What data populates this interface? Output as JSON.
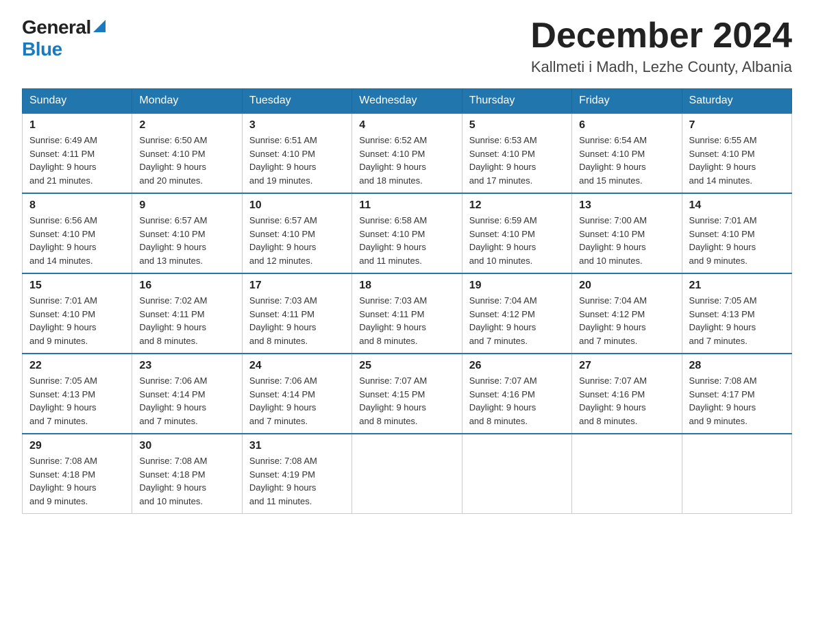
{
  "header": {
    "logo_general": "General",
    "logo_blue": "Blue",
    "month_title": "December 2024",
    "location": "Kallmeti i Madh, Lezhe County, Albania"
  },
  "weekdays": [
    "Sunday",
    "Monday",
    "Tuesday",
    "Wednesday",
    "Thursday",
    "Friday",
    "Saturday"
  ],
  "weeks": [
    [
      {
        "day": "1",
        "sunrise": "6:49 AM",
        "sunset": "4:11 PM",
        "daylight": "9 hours and 21 minutes."
      },
      {
        "day": "2",
        "sunrise": "6:50 AM",
        "sunset": "4:10 PM",
        "daylight": "9 hours and 20 minutes."
      },
      {
        "day": "3",
        "sunrise": "6:51 AM",
        "sunset": "4:10 PM",
        "daylight": "9 hours and 19 minutes."
      },
      {
        "day": "4",
        "sunrise": "6:52 AM",
        "sunset": "4:10 PM",
        "daylight": "9 hours and 18 minutes."
      },
      {
        "day": "5",
        "sunrise": "6:53 AM",
        "sunset": "4:10 PM",
        "daylight": "9 hours and 17 minutes."
      },
      {
        "day": "6",
        "sunrise": "6:54 AM",
        "sunset": "4:10 PM",
        "daylight": "9 hours and 15 minutes."
      },
      {
        "day": "7",
        "sunrise": "6:55 AM",
        "sunset": "4:10 PM",
        "daylight": "9 hours and 14 minutes."
      }
    ],
    [
      {
        "day": "8",
        "sunrise": "6:56 AM",
        "sunset": "4:10 PM",
        "daylight": "9 hours and 14 minutes."
      },
      {
        "day": "9",
        "sunrise": "6:57 AM",
        "sunset": "4:10 PM",
        "daylight": "9 hours and 13 minutes."
      },
      {
        "day": "10",
        "sunrise": "6:57 AM",
        "sunset": "4:10 PM",
        "daylight": "9 hours and 12 minutes."
      },
      {
        "day": "11",
        "sunrise": "6:58 AM",
        "sunset": "4:10 PM",
        "daylight": "9 hours and 11 minutes."
      },
      {
        "day": "12",
        "sunrise": "6:59 AM",
        "sunset": "4:10 PM",
        "daylight": "9 hours and 10 minutes."
      },
      {
        "day": "13",
        "sunrise": "7:00 AM",
        "sunset": "4:10 PM",
        "daylight": "9 hours and 10 minutes."
      },
      {
        "day": "14",
        "sunrise": "7:01 AM",
        "sunset": "4:10 PM",
        "daylight": "9 hours and 9 minutes."
      }
    ],
    [
      {
        "day": "15",
        "sunrise": "7:01 AM",
        "sunset": "4:10 PM",
        "daylight": "9 hours and 9 minutes."
      },
      {
        "day": "16",
        "sunrise": "7:02 AM",
        "sunset": "4:11 PM",
        "daylight": "9 hours and 8 minutes."
      },
      {
        "day": "17",
        "sunrise": "7:03 AM",
        "sunset": "4:11 PM",
        "daylight": "9 hours and 8 minutes."
      },
      {
        "day": "18",
        "sunrise": "7:03 AM",
        "sunset": "4:11 PM",
        "daylight": "9 hours and 8 minutes."
      },
      {
        "day": "19",
        "sunrise": "7:04 AM",
        "sunset": "4:12 PM",
        "daylight": "9 hours and 7 minutes."
      },
      {
        "day": "20",
        "sunrise": "7:04 AM",
        "sunset": "4:12 PM",
        "daylight": "9 hours and 7 minutes."
      },
      {
        "day": "21",
        "sunrise": "7:05 AM",
        "sunset": "4:13 PM",
        "daylight": "9 hours and 7 minutes."
      }
    ],
    [
      {
        "day": "22",
        "sunrise": "7:05 AM",
        "sunset": "4:13 PM",
        "daylight": "9 hours and 7 minutes."
      },
      {
        "day": "23",
        "sunrise": "7:06 AM",
        "sunset": "4:14 PM",
        "daylight": "9 hours and 7 minutes."
      },
      {
        "day": "24",
        "sunrise": "7:06 AM",
        "sunset": "4:14 PM",
        "daylight": "9 hours and 7 minutes."
      },
      {
        "day": "25",
        "sunrise": "7:07 AM",
        "sunset": "4:15 PM",
        "daylight": "9 hours and 8 minutes."
      },
      {
        "day": "26",
        "sunrise": "7:07 AM",
        "sunset": "4:16 PM",
        "daylight": "9 hours and 8 minutes."
      },
      {
        "day": "27",
        "sunrise": "7:07 AM",
        "sunset": "4:16 PM",
        "daylight": "9 hours and 8 minutes."
      },
      {
        "day": "28",
        "sunrise": "7:08 AM",
        "sunset": "4:17 PM",
        "daylight": "9 hours and 9 minutes."
      }
    ],
    [
      {
        "day": "29",
        "sunrise": "7:08 AM",
        "sunset": "4:18 PM",
        "daylight": "9 hours and 9 minutes."
      },
      {
        "day": "30",
        "sunrise": "7:08 AM",
        "sunset": "4:18 PM",
        "daylight": "9 hours and 10 minutes."
      },
      {
        "day": "31",
        "sunrise": "7:08 AM",
        "sunset": "4:19 PM",
        "daylight": "9 hours and 11 minutes."
      },
      null,
      null,
      null,
      null
    ]
  ],
  "labels": {
    "sunrise": "Sunrise:",
    "sunset": "Sunset:",
    "daylight": "Daylight:"
  }
}
